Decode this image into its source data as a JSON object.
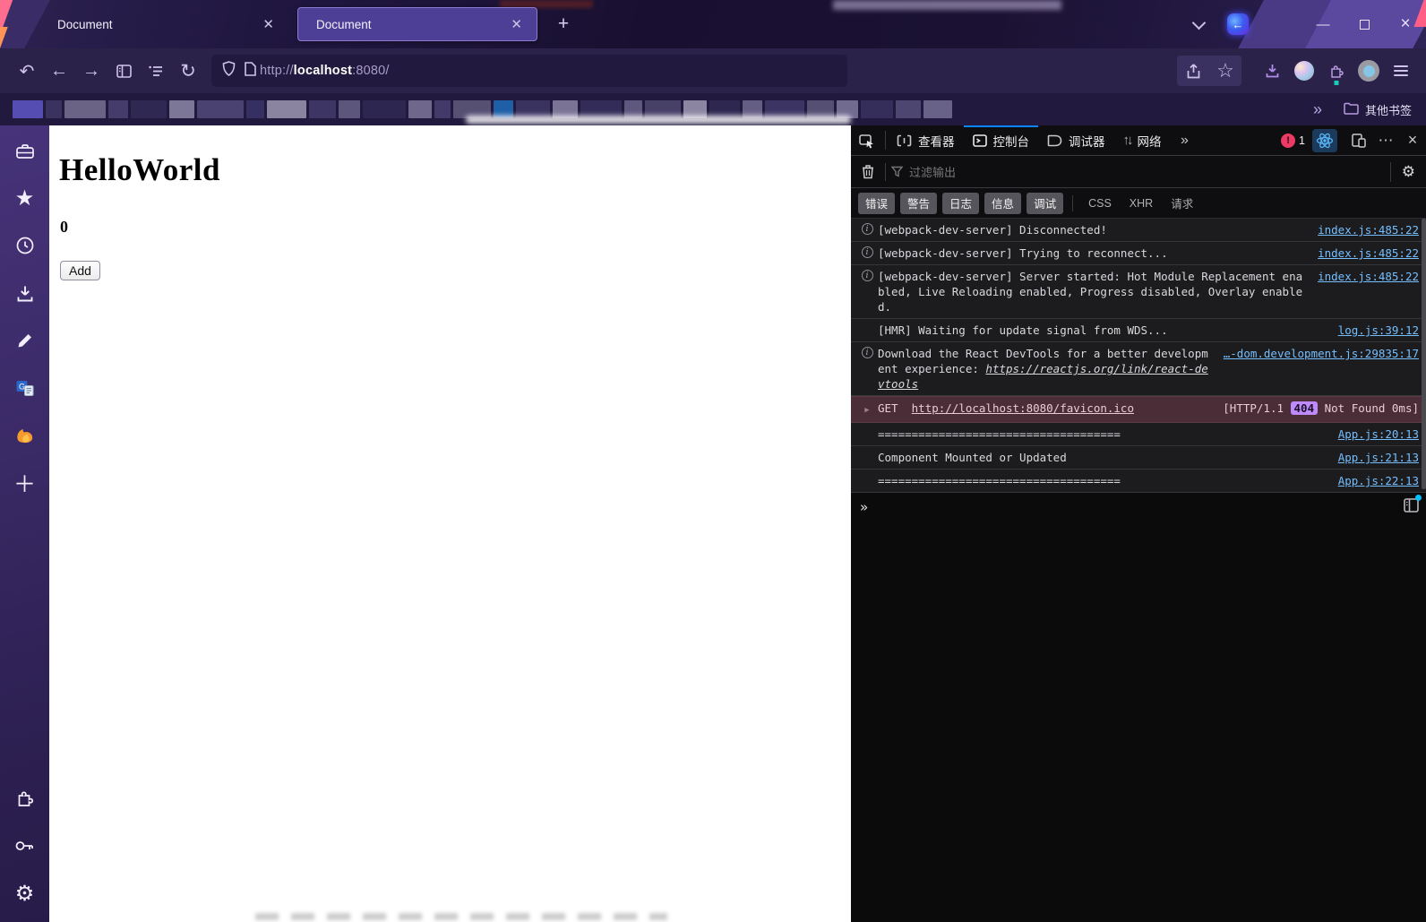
{
  "window": {
    "tabs": [
      {
        "label": "Document",
        "active": false
      },
      {
        "label": "Document",
        "active": true
      }
    ],
    "new_tab": "+",
    "minimize": "—",
    "close": "×"
  },
  "toolbar": {
    "url": {
      "prefix": "http://",
      "host": "localhost",
      "suffix": ":8080/"
    }
  },
  "bookmarks": {
    "overflow_chevrons": "»",
    "other_bookmarks_label": "其他书签"
  },
  "sidebar": {
    "icons_top": [
      "toolbox-icon",
      "bookmarks-star-icon",
      "history-clock-icon",
      "downloads-icon",
      "pencil-icon",
      "translate-extension-icon",
      "fox-extension-icon",
      "add-plus-icon"
    ],
    "icons_bottom": [
      "extensions-puzzle-icon",
      "passwords-key-icon",
      "settings-gear-icon"
    ]
  },
  "page": {
    "heading": "HelloWorld",
    "counter": "0",
    "add_button_label": "Add"
  },
  "devtools": {
    "tabs": [
      {
        "label": "查看器"
      },
      {
        "label": "控制台",
        "active": true
      },
      {
        "label": "调试器"
      },
      {
        "label": "网络"
      }
    ],
    "error_count": "1",
    "filter_placeholder": "过滤输出",
    "filter_buttons": [
      "错误",
      "警告",
      "日志",
      "信息",
      "调试"
    ],
    "filter_links": [
      "CSS",
      "XHR",
      "请求"
    ],
    "messages": [
      {
        "type": "info",
        "text": "[webpack-dev-server] Disconnected!",
        "source": "index.js:485:22"
      },
      {
        "type": "info",
        "text": "[webpack-dev-server] Trying to reconnect...",
        "source": "index.js:485:22"
      },
      {
        "type": "info",
        "text": "[webpack-dev-server] Server started: Hot Module Replacement enabled, Live Reloading enabled, Progress disabled, Overlay enabled.",
        "source": "index.js:485:22"
      },
      {
        "type": "log",
        "text": "[HMR] Waiting for update signal from WDS...",
        "source": "log.js:39:12"
      },
      {
        "type": "info",
        "text": "Download the React DevTools for a better development experience: ",
        "link": "https://reactjs.org/link/react-devtools",
        "source": "…-dom.development.js:29835:17"
      },
      {
        "type": "network-error",
        "method": "GET",
        "url": "http://localhost:8080/favicon.ico",
        "status_prefix": "[HTTP/1.1",
        "status_code": "404",
        "status_suffix": "Not Found 0ms]"
      },
      {
        "type": "log",
        "text": "====================================",
        "source": "App.js:20:13"
      },
      {
        "type": "log",
        "text": "Component Mounted or Updated",
        "source": "App.js:21:13"
      },
      {
        "type": "log",
        "text": "====================================",
        "source": "App.js:22:13"
      }
    ],
    "prompt_chevrons": "»"
  }
}
